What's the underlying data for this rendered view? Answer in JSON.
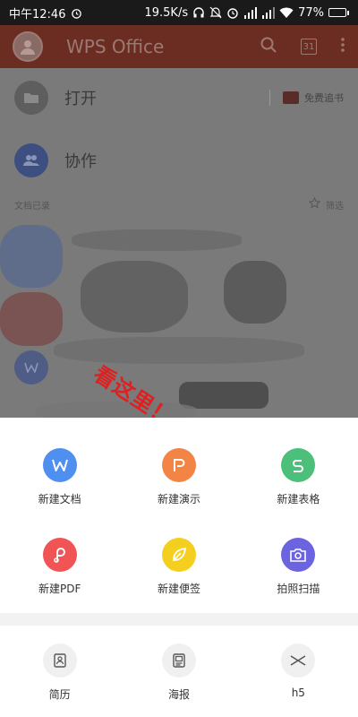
{
  "status_bar": {
    "time": "中午12:46",
    "network_speed": "19.5K/s",
    "battery": "77%"
  },
  "header": {
    "title": "WPS Office"
  },
  "background": {
    "open_label": "打开",
    "collab_label": "协作",
    "free_read_label": "免费追书",
    "recent_label": "文档已录",
    "filter_label": "筛选"
  },
  "annotation": {
    "text": "看这里！"
  },
  "create": {
    "items": [
      {
        "label": "新建文档",
        "color": "#4e8ff0",
        "icon": "w-letter-icon"
      },
      {
        "label": "新建演示",
        "color": "#f28545",
        "icon": "p-letter-icon"
      },
      {
        "label": "新建表格",
        "color": "#4cc07a",
        "icon": "s-letter-icon"
      },
      {
        "label": "新建PDF",
        "color": "#f05454",
        "icon": "pdf-icon"
      },
      {
        "label": "新建便签",
        "color": "#f5cf1f",
        "icon": "leaf-icon"
      },
      {
        "label": "拍照扫描",
        "color": "#6b63e0",
        "icon": "camera-icon"
      }
    ]
  },
  "templates": {
    "items": [
      {
        "label": "简历",
        "icon": "resume-icon"
      },
      {
        "label": "海报",
        "icon": "poster-icon"
      },
      {
        "label": "h5",
        "icon": "h5-icon"
      }
    ]
  }
}
